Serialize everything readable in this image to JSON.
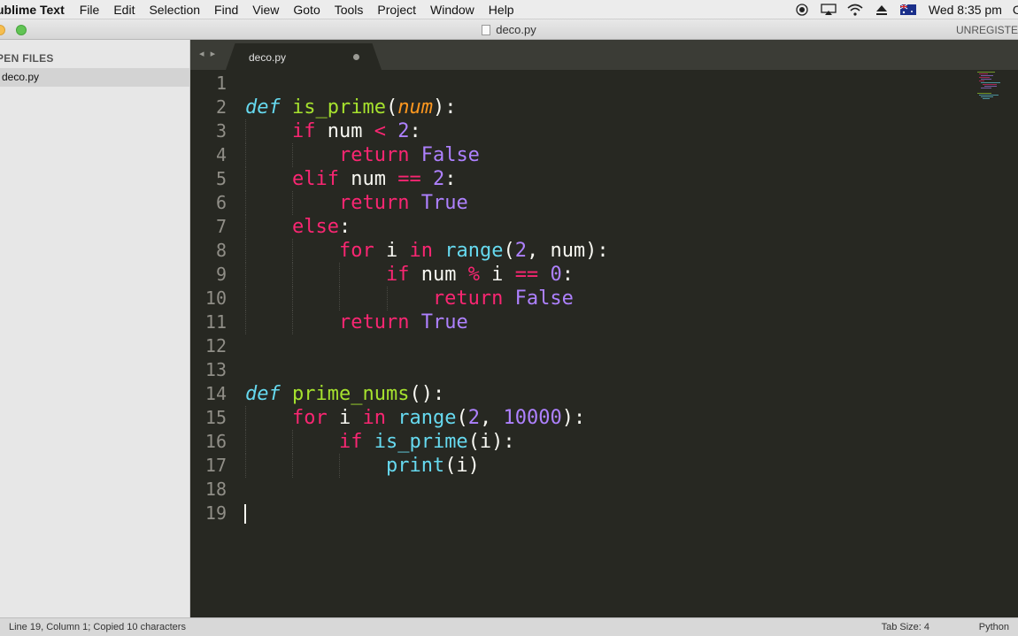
{
  "menubar": {
    "app_name": "ublime Text",
    "items": [
      "File",
      "Edit",
      "Selection",
      "Find",
      "View",
      "Goto",
      "Tools",
      "Project",
      "Window",
      "Help"
    ],
    "clock": "Wed 8:35 pm",
    "cut_char": "C"
  },
  "titlebar": {
    "title": "deco.py",
    "unregistered": "UNREGISTE"
  },
  "sidebar": {
    "section_title": "PEN FILES",
    "files": [
      "deco.py"
    ]
  },
  "tabs": {
    "nav": "◂ ▸",
    "active_tab": "deco.py"
  },
  "editor": {
    "line_numbers": [
      "1",
      "2",
      "3",
      "4",
      "5",
      "6",
      "7",
      "8",
      "9",
      "10",
      "11",
      "12",
      "13",
      "14",
      "15",
      "16",
      "17",
      "18",
      "19"
    ],
    "lines": [
      "",
      "def is_prime(num):",
      "    if num < 2:",
      "        return False",
      "    elif num == 2:",
      "        return True",
      "    else:",
      "        for i in range(2, num):",
      "            if num % i == 0:",
      "                return False",
      "        return True",
      "",
      "",
      "def prime_nums():",
      "    for i in range(2, 10000):",
      "        if is_prime(i):",
      "            print(i)",
      "",
      ""
    ],
    "colors": {
      "background": "#272822",
      "keyword": "#f92672",
      "def": "#66d9ef",
      "function": "#a6e22e",
      "param": "#fd971f",
      "constant": "#ae81ff",
      "builtin": "#66d9ef",
      "text": "#f8f8f2"
    }
  },
  "statusbar": {
    "text": "Line 19, Column 1; Copied 10 characters",
    "tab_size": "Tab Size: 4",
    "syntax": "Python"
  }
}
